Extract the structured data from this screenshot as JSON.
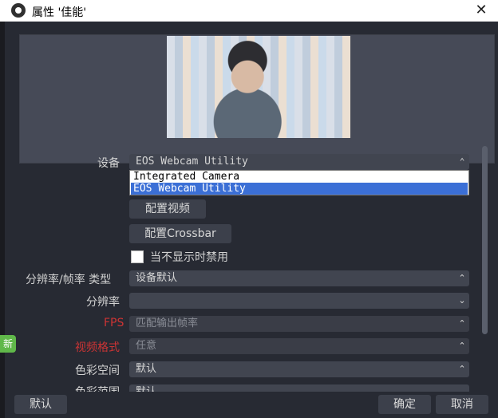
{
  "window": {
    "title": "属性 '佳能'",
    "close_symbol": "✕"
  },
  "form": {
    "device": {
      "label": "设备",
      "value": "EOS Webcam Utility",
      "options": [
        "Integrated Camera",
        "EOS Webcam Utility"
      ],
      "chevron": "⌃⌄"
    },
    "config_video_button": "配置视频",
    "config_crossbar_button": "配置Crossbar",
    "disable_when_hidden": {
      "label": "当不显示时禁用",
      "checked": false
    },
    "res_type": {
      "label": "分辨率/帧率 类型",
      "value": "设备默认"
    },
    "resolution": {
      "label": "分辨率",
      "value": ""
    },
    "fps": {
      "label": "FPS",
      "value": "匹配输出帧率"
    },
    "video_format": {
      "label": "视频格式",
      "value": "任意"
    },
    "color_space": {
      "label": "色彩空间",
      "value": "默认"
    },
    "color_range": {
      "label": "色彩范围",
      "value": "默认"
    }
  },
  "footer": {
    "default_button": "默认",
    "ok_button": "确定",
    "cancel_button": "取消"
  },
  "side_badge": "新",
  "colors": {
    "dialog_bg": "#272a33",
    "field_bg": "#414550",
    "selection": "#3b6fd6",
    "error_label": "#cc3434",
    "badge": "#60b84a"
  }
}
